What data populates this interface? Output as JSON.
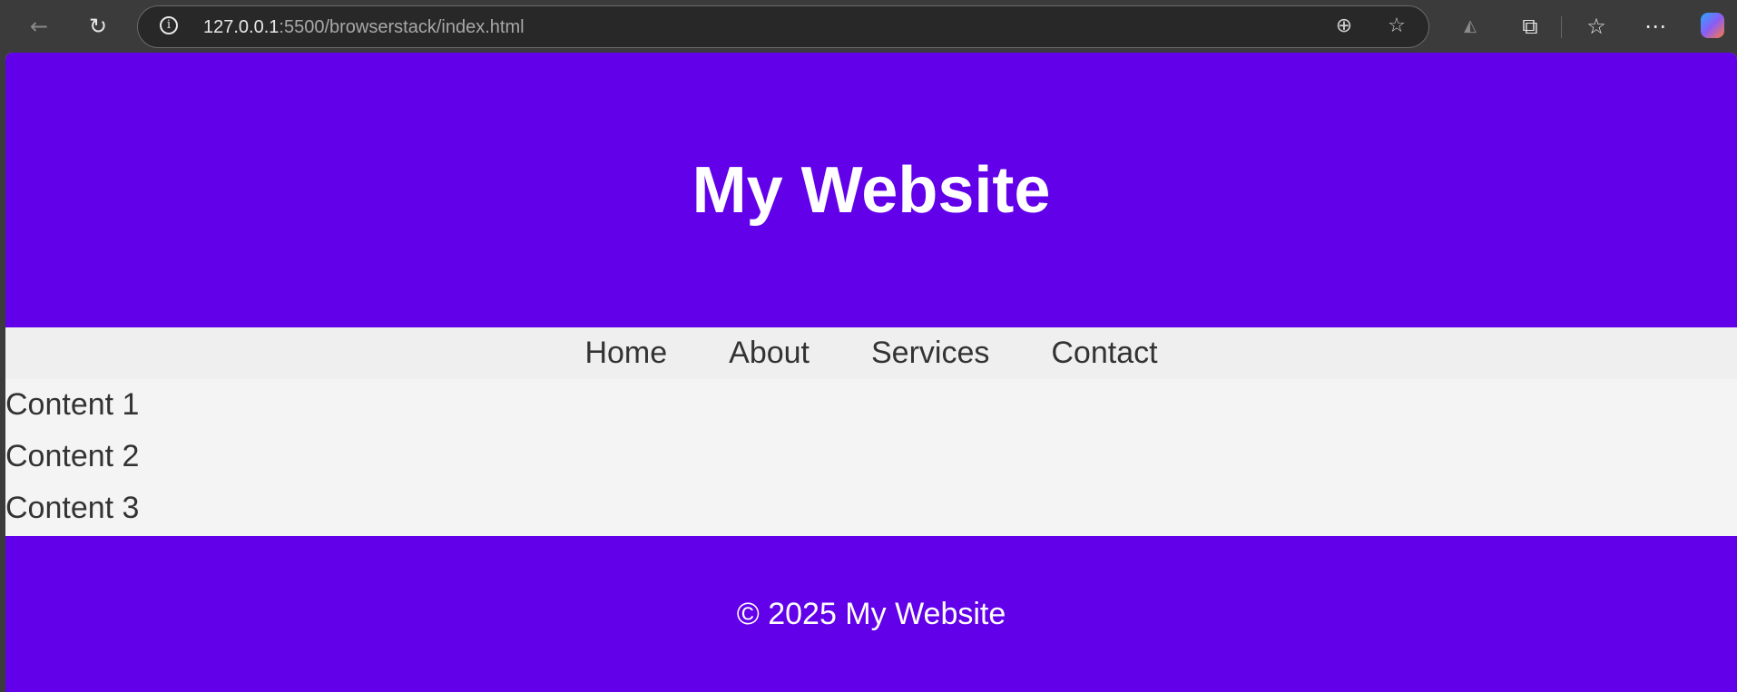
{
  "browser": {
    "url_host": "127.0.0.1",
    "url_rest": ":5500/browserstack/index.html",
    "icons": [
      "back-icon",
      "refresh-icon",
      "info-icon",
      "zoom-icon",
      "favorite-star-icon",
      "app-icon",
      "extensions-icon",
      "favorites-icon",
      "more-icon",
      "copilot-icon"
    ]
  },
  "header": {
    "title": "My Website"
  },
  "nav": {
    "items": [
      "Home",
      "About",
      "Services",
      "Contact"
    ]
  },
  "content": {
    "items": [
      "Content 1",
      "Content 2",
      "Content 3"
    ]
  },
  "footer": {
    "text": "© 2025 My Website"
  },
  "colors": {
    "brand": "#6200ea",
    "nav_bg": "#efefef",
    "content_bg": "#f4f4f4",
    "text": "#333333"
  }
}
